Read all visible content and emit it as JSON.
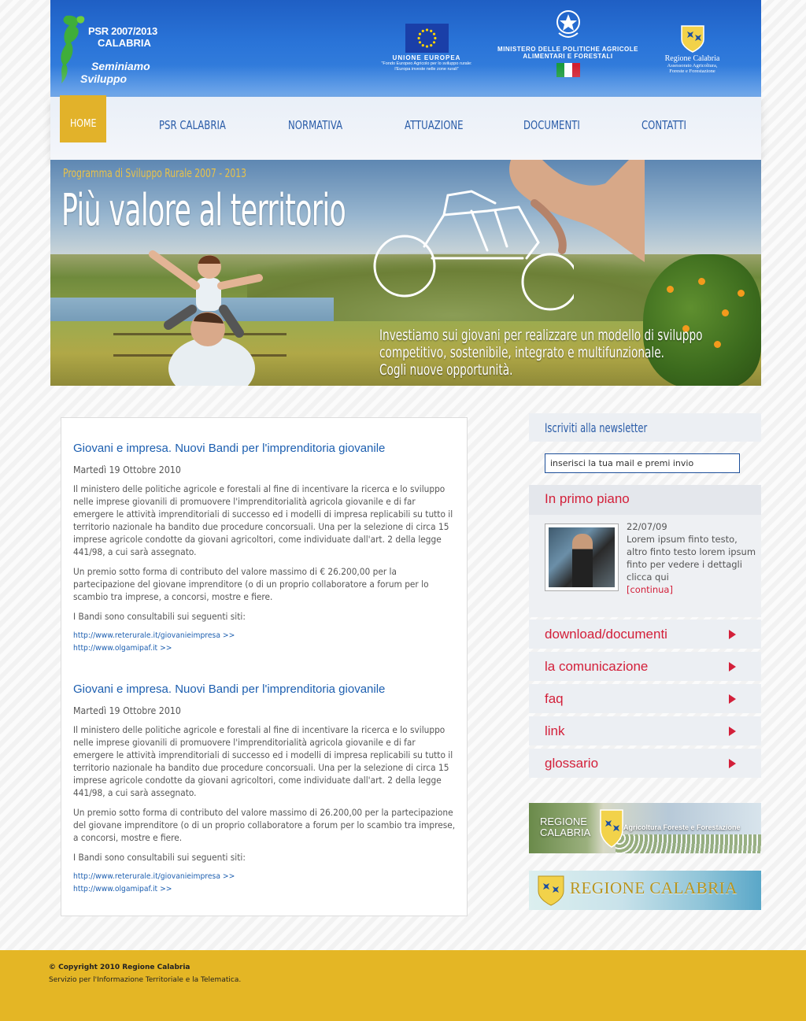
{
  "header": {
    "psr_logo": {
      "line1": "PSR 2007/2013",
      "line2": "CALABRIA",
      "line3": "Seminiamo",
      "line4": "Sviluppo"
    },
    "eu_logo": {
      "title": "UNIONE EUROPEA",
      "line1": "\"Fondo Europeo Agricolo per lo sviluppo rurale:",
      "line2": "l'Europa investe nelle zone rurali\""
    },
    "ministry_logo": {
      "line1": "MINISTERO DELLE POLITICHE AGRICOLE",
      "line2": "ALIMENTARI E FORESTALI"
    },
    "region_logo": {
      "title": "Regione Calabria",
      "line1": "Assessorato Agricoltura,",
      "line2": "Foreste e Forestazione"
    }
  },
  "nav": {
    "items": [
      {
        "label": "HOME",
        "active": true
      },
      {
        "label": "PSR CALABRIA"
      },
      {
        "label": "NORMATIVA"
      },
      {
        "label": "ATTUAZIONE"
      },
      {
        "label": "DOCUMENTI"
      },
      {
        "label": "CONTATTI"
      }
    ]
  },
  "banner": {
    "subtitle": "Programma di Sviluppo Rurale 2007 - 2013",
    "title": "Più valore al territorio",
    "tagline1": "Investiamo sui giovani per realizzare un modello di sviluppo",
    "tagline2": "competitivo, sostenibile, integrato e multifunzionale.",
    "tagline3": "Cogli nuove opportunità."
  },
  "articles": [
    {
      "title": "Giovani e impresa. Nuovi Bandi per l'imprenditoria giovanile",
      "date": "Martedì 19 Ottobre 2010",
      "p1": "Il ministero delle politiche agricole e forestali al fine di incentivare la ricerca e lo sviluppo nelle imprese giovanili di promuovere l'imprenditorialità agricola giovanile e di far emergere le attività imprenditoriali di successo ed i modelli di impresa replicabili su tutto il territorio nazionale ha bandito due procedure concorsuali. Una per la selezione di circa 15 imprese agricole condotte da giovani agricoltori, come individuate dall'art. 2 della legge 441/98, a cui sarà assegnato.",
      "p2": "Un premio sotto forma di contributo del valore massimo di € 26.200,00 per la partecipazione del giovane imprenditore (o di un proprio collaboratore a forum per lo scambio tra imprese, a concorsi, mostre e fiere.",
      "p3": "I Bandi sono consultabili sui seguenti siti:",
      "link1": "http://www.reterurale.it/giovanieimpresa >>",
      "link2": "http://www.olgamipaf.it >>"
    },
    {
      "title": "Giovani e impresa. Nuovi Bandi per l'imprenditoria giovanile",
      "date": "Martedì 19 Ottobre 2010",
      "p1": "Il ministero delle politiche agricole e forestali al fine di incentivare la ricerca e lo sviluppo nelle imprese giovanili di promuovere l'imprenditorialità agricola giovanile e di far emergere le attività imprenditoriali di successo ed i modelli di impresa replicabili su tutto il territorio nazionale ha bandito due procedure concorsuali. Una per la selezione di circa 15 imprese agricole condotte da giovani agricoltori, come individuate dall'art. 2 della legge 441/98, a cui sarà assegnato.",
      "p2": "Un premio sotto forma di contributo del valore massimo di 26.200,00 per la partecipazione del giovane imprenditore (o di un proprio collaboratore a forum per lo scambio tra imprese, a concorsi, mostre e fiere.",
      "p3": "I Bandi sono consultabili sui seguenti siti:",
      "link1": "http://www.reterurale.it/giovanieimpresa >>",
      "link2": "http://www.olgamipaf.it >>"
    }
  ],
  "sidebar": {
    "newsletter_title": "Iscriviti alla newsletter",
    "newsletter_value": "inserisci la tua mail e premi invio",
    "primo_piano": {
      "title": "In primo piano",
      "date": "22/07/09",
      "text": "Lorem ipsum finto testo, altro finto testo lorem ipsum finto per vedere i dettagli clicca qui",
      "more": "[continua]"
    },
    "links": [
      "download/documenti",
      "la comunicazione",
      "faq",
      "link",
      "glossario"
    ],
    "banner1": {
      "line1": "REGIONE",
      "line2": "CALABRIA",
      "caption": "Agricoltura Foreste e Forestazione"
    },
    "banner2": {
      "text": "REGIONE  CALABRIA"
    }
  },
  "footer": {
    "copyright": "© Copyright 2010 Regione Calabria",
    "service": "Servizio per l'Informazione Territoriale e la Telematica."
  },
  "colors": {
    "header_blue": "#2a74d8",
    "nav_text": "#2a5ca8",
    "accent_gold": "#e2b22a",
    "link_red": "#d3203a",
    "title_blue": "#1d5fb0",
    "footer_gold": "#e4b625"
  }
}
